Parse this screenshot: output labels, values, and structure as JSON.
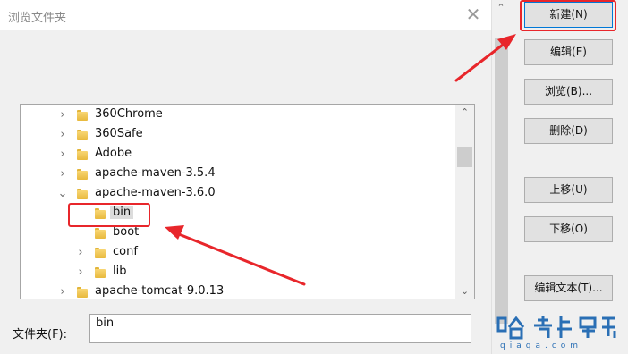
{
  "dialog": {
    "title": "浏览文件夹",
    "close_glyph": "✕",
    "tree": {
      "items": [
        {
          "label": "360Chrome",
          "chevron": "›",
          "indent": 0,
          "selected": false
        },
        {
          "label": "360Safe",
          "chevron": "›",
          "indent": 0,
          "selected": false
        },
        {
          "label": "Adobe",
          "chevron": "›",
          "indent": 0,
          "selected": false
        },
        {
          "label": "apache-maven-3.5.4",
          "chevron": "›",
          "indent": 0,
          "selected": false
        },
        {
          "label": "apache-maven-3.6.0",
          "chevron": "⌄",
          "indent": 0,
          "selected": false
        },
        {
          "label": "bin",
          "chevron": "",
          "indent": 1,
          "selected": true
        },
        {
          "label": "boot",
          "chevron": "",
          "indent": 1,
          "selected": false
        },
        {
          "label": "conf",
          "chevron": "›",
          "indent": 1,
          "selected": false
        },
        {
          "label": "lib",
          "chevron": "›",
          "indent": 1,
          "selected": false
        },
        {
          "label": "apache-tomcat-9.0.13",
          "chevron": "›",
          "indent": 0,
          "selected": false
        }
      ],
      "scroll_up_glyph": "⌃",
      "scroll_down_glyph": "⌄"
    },
    "folder_field": {
      "label": "文件夹(F):",
      "value": "bin"
    }
  },
  "outer_scrollbar": {
    "up_glyph": "⌃"
  },
  "buttons": {
    "new": "新建(N)",
    "edit": "编辑(E)",
    "browse": "浏览(B)...",
    "delete": "删除(D)",
    "move_up": "上移(U)",
    "move_down": "下移(O)",
    "edit_text": "编辑文本(T)..."
  },
  "colors": {
    "annotation_red": "#e8262b",
    "folder_yellow": "#f2c94c",
    "watermark_blue": "#2a6fb5"
  },
  "watermark": {
    "text": "qiaqa.com",
    "icon": "site-logo"
  }
}
